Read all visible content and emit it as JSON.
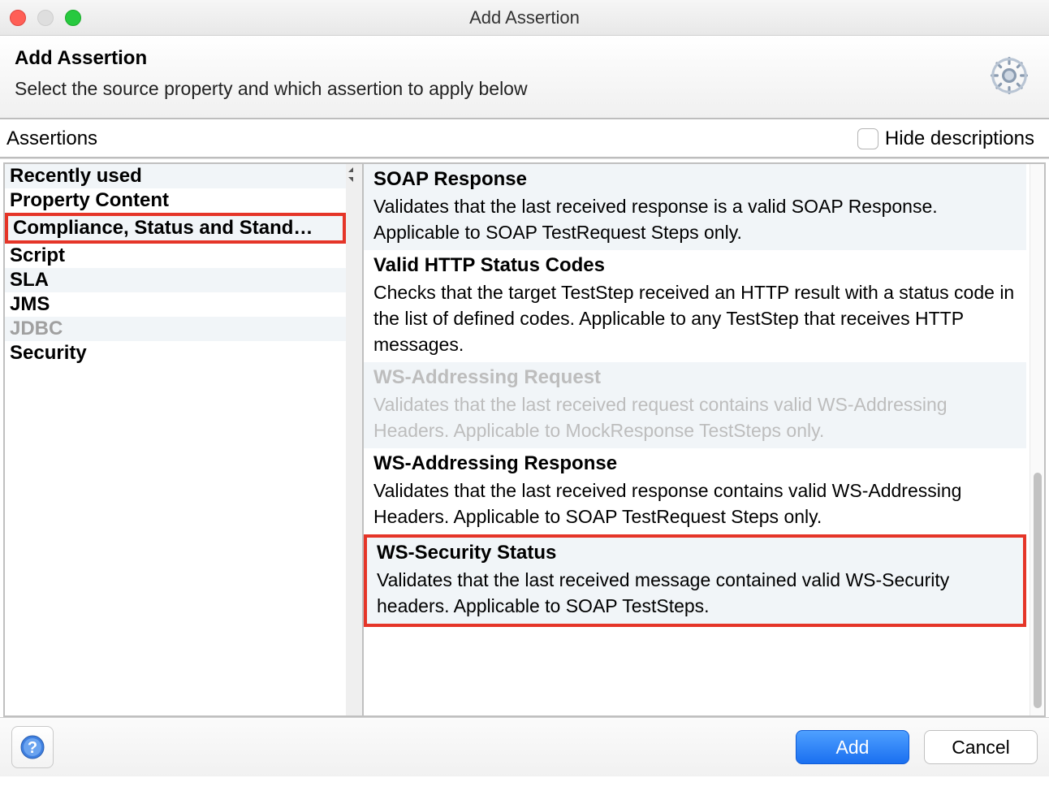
{
  "window": {
    "title": "Add Assertion"
  },
  "header": {
    "title": "Add Assertion",
    "subtitle": "Select the source property and which assertion to apply below"
  },
  "subbar": {
    "left_label": "Assertions",
    "hide_desc_label": "Hide descriptions",
    "hide_desc_checked": false
  },
  "categories": [
    {
      "label": "Recently used",
      "disabled": false,
      "highlighted": false
    },
    {
      "label": "Property Content",
      "disabled": false,
      "highlighted": false
    },
    {
      "label": "Compliance, Status and Stand…",
      "disabled": false,
      "highlighted": true
    },
    {
      "label": "Script",
      "disabled": false,
      "highlighted": false
    },
    {
      "label": "SLA",
      "disabled": false,
      "highlighted": false
    },
    {
      "label": "JMS",
      "disabled": false,
      "highlighted": false
    },
    {
      "label": "JDBC",
      "disabled": true,
      "highlighted": false
    },
    {
      "label": "Security",
      "disabled": false,
      "highlighted": false
    }
  ],
  "assertions": [
    {
      "title": "SOAP Response",
      "desc": "Validates that the last received response is a valid SOAP Response. Applicable to SOAP TestRequest Steps only.",
      "disabled": false,
      "highlighted": false
    },
    {
      "title": "Valid HTTP Status Codes",
      "desc": "Checks that the target TestStep received an HTTP result with a status code in the list of defined codes. Applicable to any TestStep that receives HTTP messages.",
      "disabled": false,
      "highlighted": false
    },
    {
      "title": "WS-Addressing Request",
      "desc": "Validates that the last received request contains valid WS-Addressing Headers. Applicable to MockResponse TestSteps only.",
      "disabled": true,
      "highlighted": false
    },
    {
      "title": "WS-Addressing Response",
      "desc": "Validates that the last received response contains valid WS-Addressing Headers. Applicable to SOAP TestRequest Steps only.",
      "disabled": false,
      "highlighted": false
    },
    {
      "title": "WS-Security Status",
      "desc": "Validates that the last received message contained valid WS-Security headers. Applicable to SOAP TestSteps.",
      "disabled": false,
      "highlighted": true
    }
  ],
  "footer": {
    "add_label": "Add",
    "cancel_label": "Cancel"
  }
}
